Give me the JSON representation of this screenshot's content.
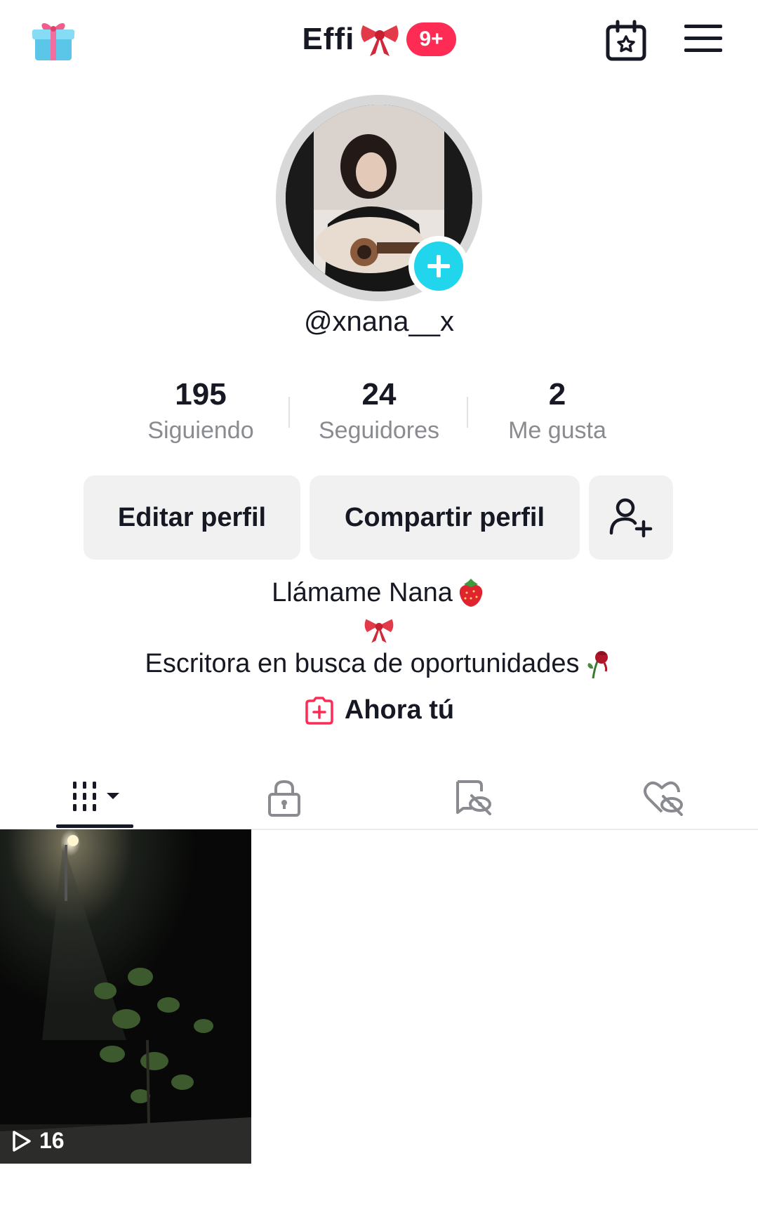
{
  "header": {
    "title": "Effi",
    "notification_count": "9+",
    "icons": [
      "gift-icon",
      "bow-icon",
      "calendar-star-icon",
      "menu-icon"
    ]
  },
  "profile": {
    "username": "@xnana__x"
  },
  "stats": [
    {
      "value": "195",
      "label": "Siguiendo"
    },
    {
      "value": "24",
      "label": "Seguidores"
    },
    {
      "value": "2",
      "label": "Me gusta"
    }
  ],
  "actions": {
    "edit": "Editar perfil",
    "share": "Compartir perfil"
  },
  "bio": {
    "line1": "Llámame Nana",
    "line3": "Escritora en busca de oportunidades"
  },
  "now": {
    "label": "Ahora tú"
  },
  "tabs": [
    "videos-grid-icon",
    "lock-icon",
    "repost-hidden-icon",
    "liked-hidden-icon"
  ],
  "videos": [
    {
      "views": "16"
    }
  ],
  "colors": {
    "accent": "#fe2c55",
    "plus_badge": "#20d5ec",
    "button_bg": "#f1f1f2",
    "muted_text": "#8a8b91"
  }
}
